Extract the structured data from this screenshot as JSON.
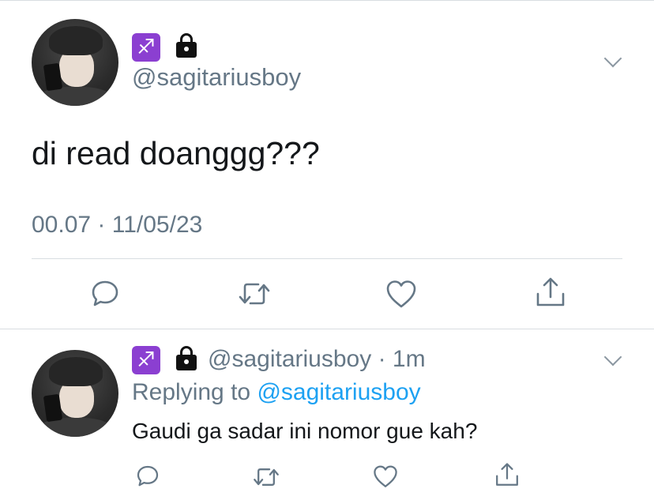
{
  "main_tweet": {
    "handle": "@sagitariusboy",
    "zodiac_icon": "♐",
    "text": "di read doanggg???",
    "time": "00.07",
    "separator": "·",
    "date": "11/05/23"
  },
  "reply_tweet": {
    "handle": "@sagitariusboy",
    "separator": "·",
    "age": "1m",
    "zodiac_icon": "♐",
    "replying_prefix": "Replying to",
    "replying_mention": "@sagitariusboy",
    "text": "Gaudi ga sadar ini nomor gue kah?"
  },
  "icons": {
    "reply": "comment-icon",
    "retweet": "retweet-icon",
    "like": "heart-icon",
    "share": "share-icon",
    "menu": "chevron-down-icon",
    "lock": "lock-icon"
  },
  "colors": {
    "text": "#14171a",
    "muted": "#657786",
    "link": "#1da1f2",
    "zodiac": "#8b3fd1",
    "divider": "#d8dde1"
  }
}
